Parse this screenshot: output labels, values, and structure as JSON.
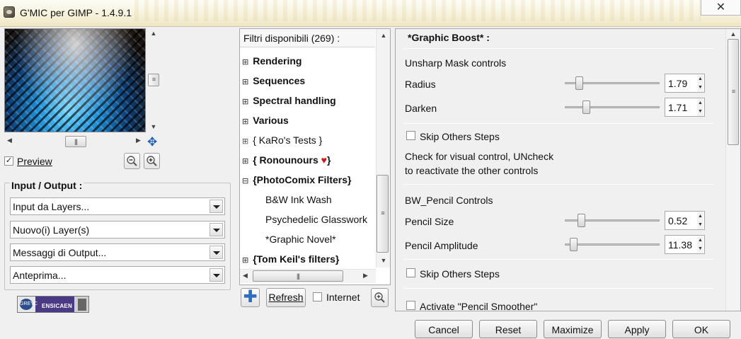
{
  "window": {
    "title": "G'MIC per GIMP - 1.4.9.1",
    "close_glyph": "✕"
  },
  "preview": {
    "checkbox_label": "Preview",
    "checked": true,
    "zoom_out_icon": "zoom-out-icon",
    "zoom_in_icon": "zoom-in-icon",
    "move_icon": "move-icon"
  },
  "io": {
    "title": "Input / Output :",
    "combos": [
      {
        "value": "Input da Layers..."
      },
      {
        "value": "Nuovo(i) Layer(s)"
      },
      {
        "value": "Messaggi di Output..."
      },
      {
        "value": "Anteprima..."
      }
    ]
  },
  "logo": {
    "left_text": "GREYC",
    "mid_text": "ENSICAEN"
  },
  "filters": {
    "header": "Filtri disponibili (269) :",
    "items": [
      {
        "label": "Rendering",
        "bold": true,
        "expander": "⊞",
        "indent": 0
      },
      {
        "label": "Sequences",
        "bold": true,
        "expander": "⊞",
        "indent": 0
      },
      {
        "label": "Spectral handling",
        "bold": true,
        "expander": "⊞",
        "indent": 0
      },
      {
        "label": "Various",
        "bold": true,
        "expander": "⊞",
        "indent": 0
      },
      {
        "label": "{ KaRo's Tests }",
        "bold": false,
        "expander": "⊞",
        "indent": 0
      },
      {
        "label": "{ Ronounours ",
        "bold": true,
        "expander": "⊞",
        "indent": 0,
        "suffix": "♥",
        "suffix2": "}"
      },
      {
        "label": "{PhotoComix Filters}",
        "bold": true,
        "expander": "⊟",
        "indent": 0
      },
      {
        "label": "B&W Ink Wash",
        "bold": false,
        "expander": "",
        "indent": 1
      },
      {
        "label": "Psychedelic Glasswork",
        "bold": false,
        "expander": "",
        "indent": 1
      },
      {
        "label": "*Graphic Novel*",
        "bold": false,
        "expander": "",
        "indent": 1
      },
      {
        "label": "{Tom Keil's filters}",
        "bold": true,
        "expander": "⊞",
        "indent": 0
      }
    ],
    "add_icon": "add-favorite-icon",
    "refresh_label": "Refresh",
    "internet_label": "Internet",
    "internet_checked": false,
    "search_icon": "search-icon"
  },
  "params": {
    "title": "*Graphic Boost* :",
    "section1": "Unsharp Mask controls",
    "radius_label": "Radius",
    "radius_value": "1.79",
    "radius_level": 0.12,
    "darken_label": "Darken",
    "darken_value": "1.71",
    "darken_level": 0.2,
    "skip1_label": "Skip Others Steps",
    "check_note_1": "Check for visual control, UNcheck",
    "check_note_2": "to reactivate the other controls",
    "section2": "BW_Pencil Controls",
    "pencil_size_label": "Pencil Size",
    "pencil_size_value": "0.52",
    "pencil_size_level": 0.15,
    "pencil_amp_label": "Pencil Amplitude",
    "pencil_amp_value": "11.38",
    "pencil_amp_level": 0.06,
    "skip2_label": "Skip Others Steps",
    "smoother_label": "Activate \"Pencil Smoother\""
  },
  "buttons": {
    "cancel": "Cancel",
    "reset": "Reset",
    "maximize": "Maximize",
    "apply": "Apply",
    "ok": "OK"
  }
}
